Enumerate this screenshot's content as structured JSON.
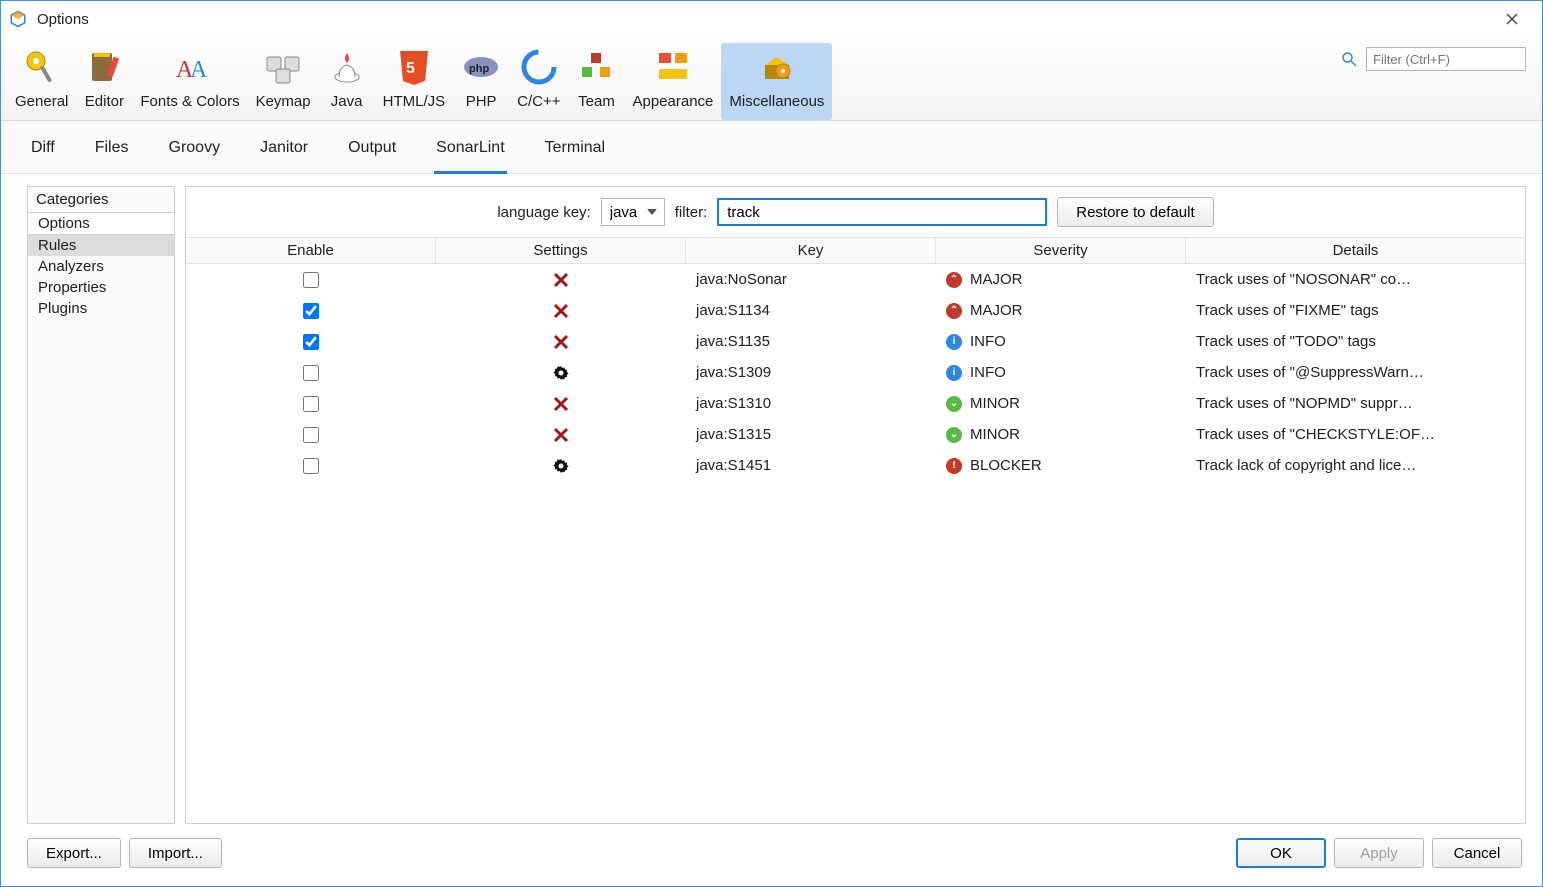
{
  "window": {
    "title": "Options"
  },
  "search": {
    "placeholder": "Filter (Ctrl+F)"
  },
  "toolbar": {
    "items": [
      {
        "id": "general",
        "label": "General"
      },
      {
        "id": "editor",
        "label": "Editor"
      },
      {
        "id": "fonts",
        "label": "Fonts & Colors"
      },
      {
        "id": "keymap",
        "label": "Keymap"
      },
      {
        "id": "java",
        "label": "Java"
      },
      {
        "id": "htmljs",
        "label": "HTML/JS"
      },
      {
        "id": "php",
        "label": "PHP"
      },
      {
        "id": "ccpp",
        "label": "C/C++"
      },
      {
        "id": "team",
        "label": "Team"
      },
      {
        "id": "appearance",
        "label": "Appearance"
      },
      {
        "id": "miscellaneous",
        "label": "Miscellaneous"
      }
    ],
    "selected": "miscellaneous"
  },
  "subtabs": {
    "items": [
      {
        "id": "diff",
        "label": "Diff"
      },
      {
        "id": "files",
        "label": "Files"
      },
      {
        "id": "groovy",
        "label": "Groovy"
      },
      {
        "id": "janitor",
        "label": "Janitor"
      },
      {
        "id": "output",
        "label": "Output"
      },
      {
        "id": "sonarlint",
        "label": "SonarLint"
      },
      {
        "id": "terminal",
        "label": "Terminal"
      }
    ],
    "active": "sonarlint"
  },
  "categories": {
    "header": "Categories",
    "items": [
      "Options",
      "Rules",
      "Analyzers",
      "Properties",
      "Plugins"
    ],
    "selected": "Rules"
  },
  "filterbar": {
    "language_label": "language key:",
    "language_value": "java",
    "filter_label": "filter:",
    "filter_value": "track",
    "restore_label": "Restore to default"
  },
  "table": {
    "columns": [
      "Enable",
      "Settings",
      "Key",
      "Severity",
      "Details"
    ],
    "rows": [
      {
        "enabled": false,
        "settings": "none",
        "key": "java:NoSonar",
        "severity": "MAJOR",
        "details": "Track uses of \"NOSONAR\" co…"
      },
      {
        "enabled": true,
        "settings": "none",
        "key": "java:S1134",
        "severity": "MAJOR",
        "details": "Track uses of \"FIXME\" tags"
      },
      {
        "enabled": true,
        "settings": "none",
        "key": "java:S1135",
        "severity": "INFO",
        "details": "Track uses of \"TODO\" tags"
      },
      {
        "enabled": false,
        "settings": "gear",
        "key": "java:S1309",
        "severity": "INFO",
        "details": "Track uses of \"@SuppressWarn…"
      },
      {
        "enabled": false,
        "settings": "none",
        "key": "java:S1310",
        "severity": "MINOR",
        "details": "Track uses of \"NOPMD\" suppr…"
      },
      {
        "enabled": false,
        "settings": "none",
        "key": "java:S1315",
        "severity": "MINOR",
        "details": "Track uses of \"CHECKSTYLE:OF…"
      },
      {
        "enabled": false,
        "settings": "gear",
        "key": "java:S1451",
        "severity": "BLOCKER",
        "details": "Track lack of copyright and lice…"
      }
    ]
  },
  "footer": {
    "export": "Export...",
    "import": "Import...",
    "ok": "OK",
    "apply": "Apply",
    "cancel": "Cancel"
  }
}
